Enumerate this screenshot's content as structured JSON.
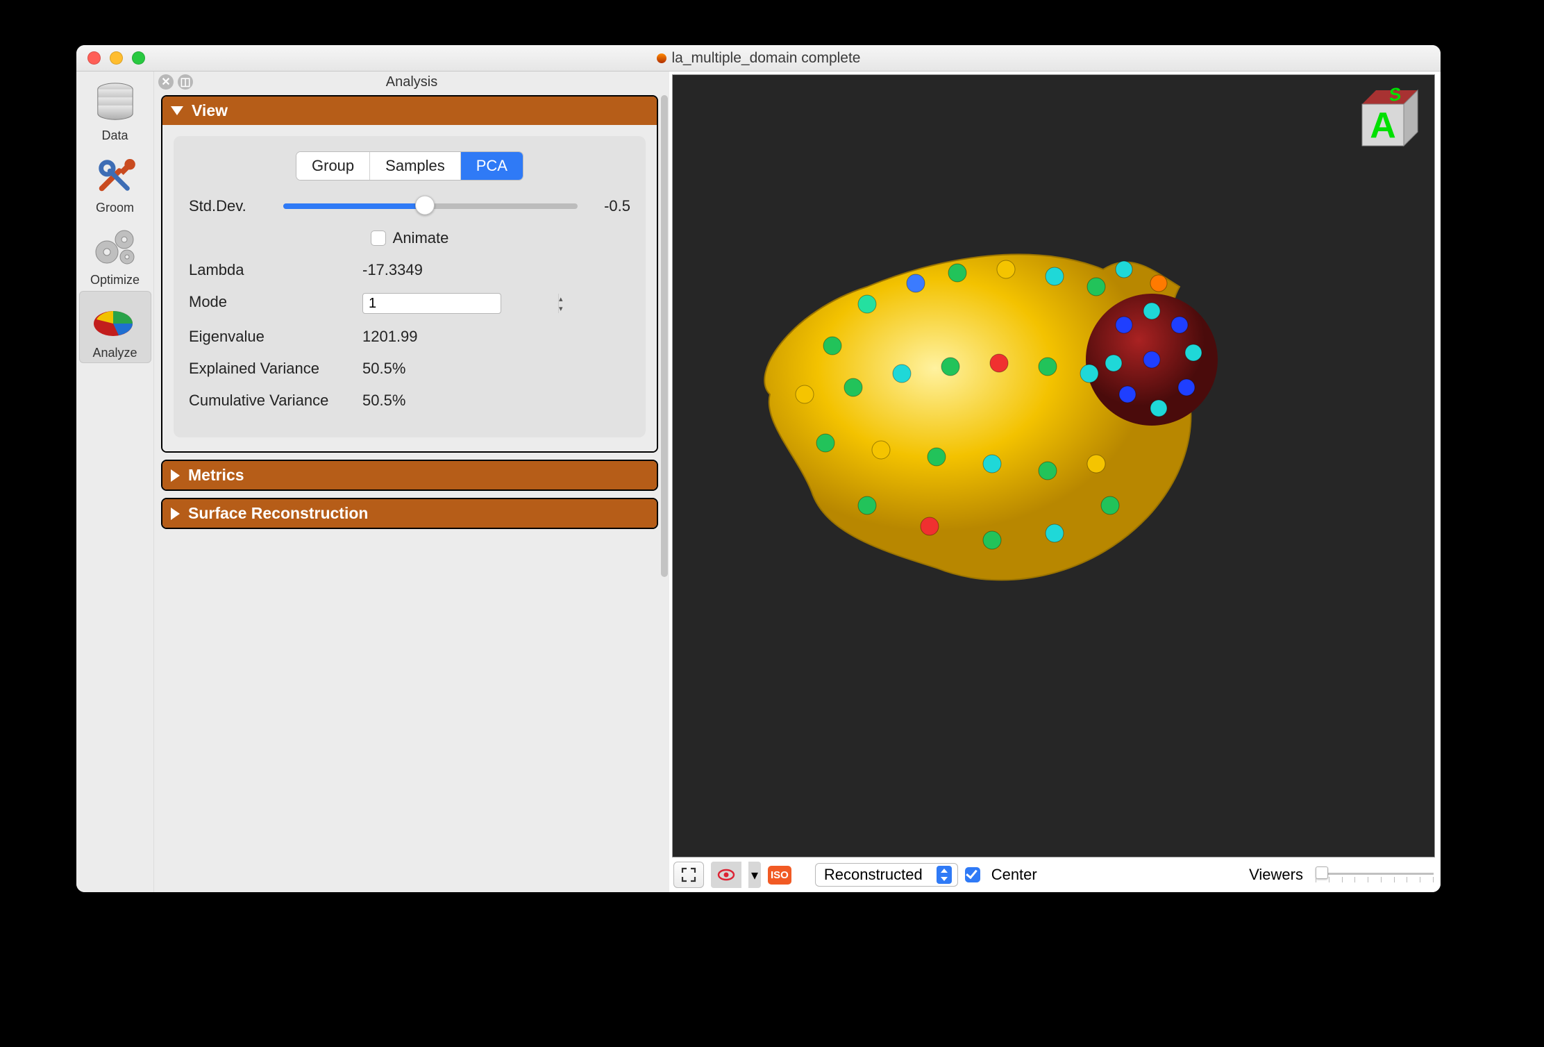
{
  "window": {
    "title": "la_multiple_domain complete"
  },
  "toolstrip": {
    "items": [
      {
        "label": "Data"
      },
      {
        "label": "Groom"
      },
      {
        "label": "Optimize"
      },
      {
        "label": "Analyze"
      }
    ]
  },
  "panel": {
    "title": "Analysis",
    "sections": {
      "view": {
        "title": "View"
      },
      "metrics": {
        "title": "Metrics"
      },
      "surface": {
        "title": "Surface Reconstruction"
      }
    }
  },
  "tabs": {
    "group": "Group",
    "samples": "Samples",
    "pca": "PCA"
  },
  "view": {
    "stddev_label": "Std.Dev.",
    "stddev_value": "-0.5",
    "animate_label": "Animate",
    "lambda_label": "Lambda",
    "lambda_value": "-17.3349",
    "mode_label": "Mode",
    "mode_value": "1",
    "eigen_label": "Eigenvalue",
    "eigen_value": "1201.99",
    "expl_label": "Explained Variance",
    "expl_value": "50.5%",
    "cum_label": "Cumulative Variance",
    "cum_value": "50.5%"
  },
  "toolbar": {
    "mode_select": "Reconstructed",
    "center_label": "Center",
    "viewers_label": "Viewers",
    "iso_label": "ISO"
  },
  "cube": {
    "front": "A",
    "top": "S"
  }
}
